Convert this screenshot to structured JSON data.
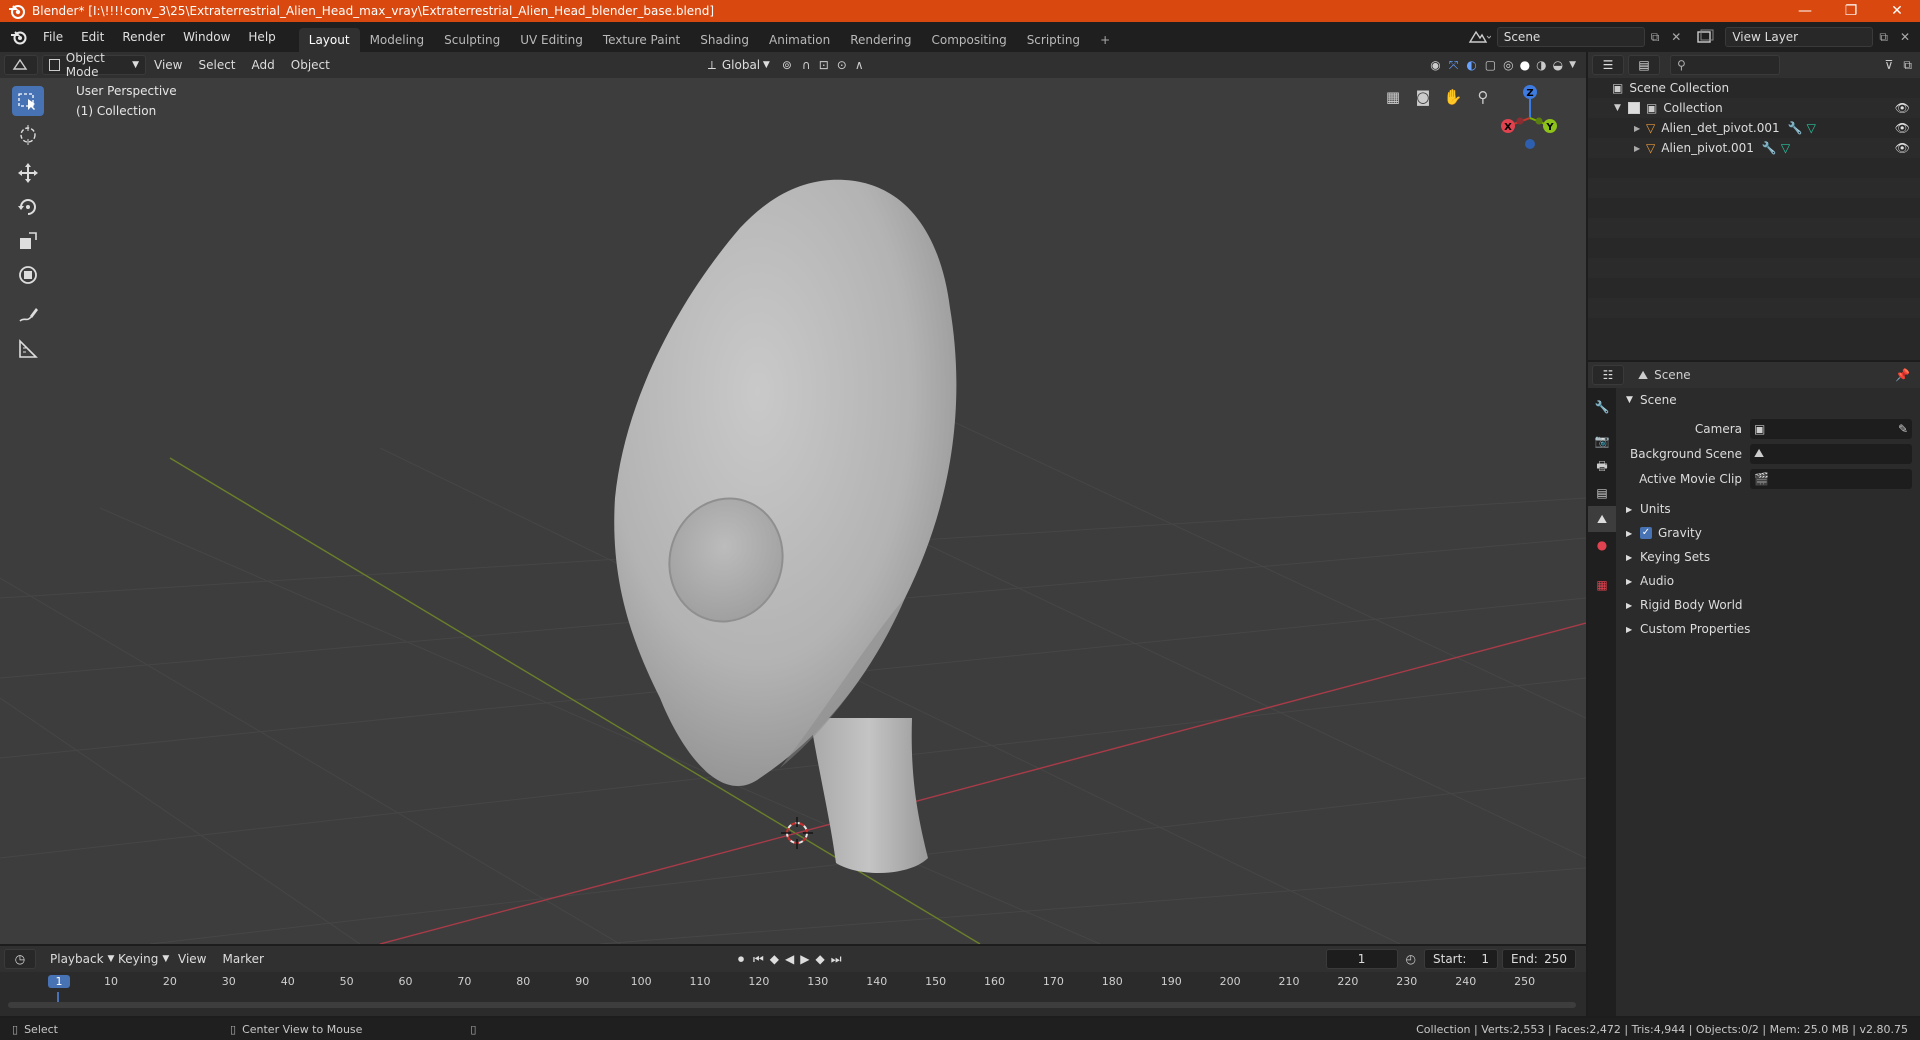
{
  "window": {
    "title": "Blender* [I:\\!!!!conv_3\\25\\Extraterrestrial_Alien_Head_max_vray\\Extraterrestrial_Alien_Head_blender_base.blend]",
    "minimize": "—",
    "maximize": "❐",
    "close": "✕"
  },
  "menu": [
    "File",
    "Edit",
    "Render",
    "Window",
    "Help"
  ],
  "workspaces": [
    "Layout",
    "Modeling",
    "Sculpting",
    "UV Editing",
    "Texture Paint",
    "Shading",
    "Animation",
    "Rendering",
    "Compositing",
    "Scripting"
  ],
  "add_tab": "+",
  "scene_selector": "Scene",
  "view_layer_selector": "View Layer",
  "viewport_header": {
    "mode": "Object Mode",
    "menus": [
      "View",
      "Select",
      "Add",
      "Object"
    ],
    "transform_orientation": "Global"
  },
  "viewport": {
    "view_name": "User Perspective",
    "collection_label": "(1) Collection",
    "gizmo": {
      "x": "X",
      "y": "Y",
      "z": "Z"
    }
  },
  "outliner": {
    "root": "Scene Collection",
    "collection": "Collection",
    "objects": [
      "Alien_det_pivot.001",
      "Alien_pivot.001"
    ]
  },
  "properties": {
    "header_title": "Scene",
    "panel_title": "Scene",
    "fields": {
      "camera_label": "Camera",
      "background_scene_label": "Background Scene",
      "active_movie_clip_label": "Active Movie Clip"
    },
    "sections": [
      {
        "label": "Units",
        "checkbox": false
      },
      {
        "label": "Gravity",
        "checkbox": true
      },
      {
        "label": "Keying Sets",
        "checkbox": false
      },
      {
        "label": "Audio",
        "checkbox": false
      },
      {
        "label": "Rigid Body World",
        "checkbox": false
      },
      {
        "label": "Custom Properties",
        "checkbox": false
      }
    ]
  },
  "timeline": {
    "menus": [
      "Playback",
      "Keying",
      "View",
      "Marker"
    ],
    "current_frame": "1",
    "start_label": "Start:",
    "start": "1",
    "end_label": "End:",
    "end": "250",
    "ruler": [
      "1",
      "10",
      "20",
      "30",
      "40",
      "50",
      "60",
      "70",
      "80",
      "90",
      "100",
      "110",
      "120",
      "130",
      "140",
      "150",
      "160",
      "170",
      "180",
      "190",
      "200",
      "210",
      "220",
      "230",
      "240",
      "250"
    ]
  },
  "status_bar": {
    "select": "Select",
    "center_view": "Center View to Mouse",
    "stats": "Collection | Verts:2,553 | Faces:2,472 | Tris:4,944 | Objects:0/2 | Mem: 25.0 MB | v2.80.75"
  },
  "colors": {
    "title_bar": "#d9480f",
    "accent": "#4772b3",
    "x_axis": "#a83b48",
    "y_axis": "#7a9a2a",
    "z_axis": "#3d7be0"
  }
}
